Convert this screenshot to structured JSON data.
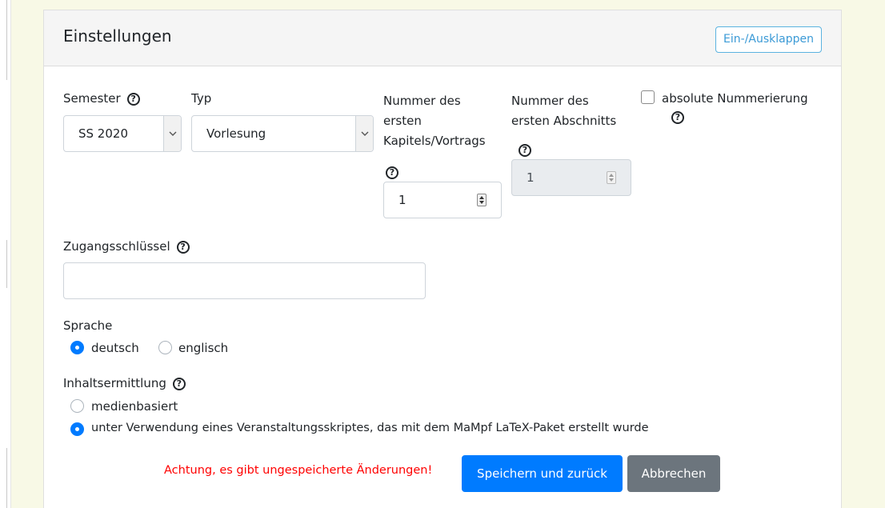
{
  "card": {
    "title": "Einstellungen",
    "collapse_button": "Ein-/Ausklappen"
  },
  "fields": {
    "semester": {
      "label": "Semester",
      "value": "SS 2020"
    },
    "type": {
      "label": "Typ",
      "value": "Vorlesung"
    },
    "first_chapter": {
      "label_line1": "Nummer des",
      "label_line2": "ersten",
      "label_line3": "Kapitels/Vortrags",
      "value": "1"
    },
    "first_section": {
      "label_line1": "Nummer des",
      "label_line2": "ersten Abschnitts",
      "value": "1"
    },
    "absolute_numbering": {
      "label": "absolute Nummerierung",
      "checked": false
    },
    "access_key": {
      "label": "Zugangsschlüssel",
      "value": ""
    },
    "language": {
      "label": "Sprache",
      "options": [
        {
          "label": "deutsch",
          "checked": true
        },
        {
          "label": "englisch",
          "checked": false
        }
      ]
    },
    "content_detection": {
      "label": "Inhaltsermittlung",
      "options": [
        {
          "label": "medienbasiert",
          "checked": false
        },
        {
          "label": "unter Verwendung eines Veranstaltungsskriptes, das mit dem MaMpf LaTeX-Paket erstellt wurde",
          "checked": true
        }
      ]
    }
  },
  "footer": {
    "warning": "Achtung, es gibt ungespeicherte Änderungen!",
    "save_button": "Speichern und zurück",
    "cancel_button": "Abbrechen"
  },
  "icons": {
    "help": "question-circle-icon",
    "help_glyph": "?"
  },
  "colors": {
    "primary": "#007bff",
    "secondary": "#6c757d",
    "warning": "#ff0000",
    "collapse_button": "#3b9ad6",
    "page_background": "#f8f9e6"
  }
}
